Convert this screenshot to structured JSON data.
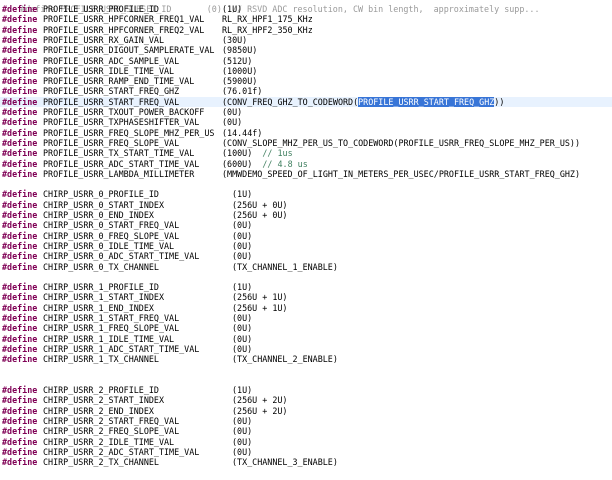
{
  "editor": {
    "top_partial": "#define PROFILE_USRR_SUBSET_ID       (0)  // RSVD ADC resolution, CW bin length,  approximately supp...",
    "lines": [
      {
        "kw": "#define",
        "name": "PROFILE_USRR_PROFILE_ID",
        "value": "(1U)",
        "col": "a"
      },
      {
        "kw": "#define",
        "name": "PROFILE_USRR_HPFCORNER_FREQ1_VAL",
        "value": "RL_RX_HPF1_175_KHz",
        "col": "a"
      },
      {
        "kw": "#define",
        "name": "PROFILE_USRR_HPFCORNER_FREQ2_VAL",
        "value": "RL_RX_HPF2_350_KHz",
        "col": "a"
      },
      {
        "kw": "#define",
        "name": "PROFILE_USRR_RX_GAIN_VAL",
        "value": "(30U)",
        "col": "a"
      },
      {
        "kw": "#define",
        "name": "PROFILE_USRR_DIGOUT_SAMPLERATE_VAL",
        "value": "(9850U)",
        "col": "a"
      },
      {
        "kw": "#define",
        "name": "PROFILE_USRR_ADC_SAMPLE_VAL",
        "value": "(512U)",
        "col": "a"
      },
      {
        "kw": "#define",
        "name": "PROFILE_USRR_IDLE_TIME_VAL",
        "value": "(1000U)",
        "col": "a"
      },
      {
        "kw": "#define",
        "name": "PROFILE_USRR_RAMP_END_TIME_VAL",
        "value": "(5900U)",
        "col": "a"
      },
      {
        "kw": "#define",
        "name": "PROFILE_USRR_START_FREQ_GHZ",
        "value": "(76.01f)",
        "col": "a"
      },
      {
        "kw": "#define",
        "name": "PROFILE_USRR_START_FREQ_VAL",
        "value": "(CONV_FREQ_GHZ_TO_CODEWORD(",
        "selected": "PROFILE_USRR_START_FREQ_GHZ",
        "value_after": "))",
        "col": "a",
        "highlight": true
      },
      {
        "kw": "#define",
        "name": "PROFILE_USRR_TXOUT_POWER_BACKOFF",
        "value": "(0U)",
        "col": "a"
      },
      {
        "kw": "#define",
        "name": "PROFILE_USRR_TXPHASESHIFTER_VAL",
        "value": "(0U)",
        "col": "a"
      },
      {
        "kw": "#define",
        "name": "PROFILE_USRR_FREQ_SLOPE_MHZ_PER_US",
        "value": "(14.44f)",
        "col": "a"
      },
      {
        "kw": "#define",
        "name": "PROFILE_USRR_FREQ_SLOPE_VAL",
        "value": "(CONV_SLOPE_MHZ_PER_US_TO_CODEWORD(PROFILE_USRR_FREQ_SLOPE_MHZ_PER_US))",
        "col": "a"
      },
      {
        "kw": "#define",
        "name": "PROFILE_USRR_TX_START_TIME_VAL",
        "value": "(100U)",
        "comment": "// 1us",
        "col": "a"
      },
      {
        "kw": "#define",
        "name": "PROFILE_USRR_ADC_START_TIME_VAL",
        "value": "(600U)",
        "comment": "// 4.8 us",
        "col": "a"
      },
      {
        "kw": "#define",
        "name": "PROFILE_USRR_LAMBDA_MILLIMETER",
        "value": "(MMWDEMO_SPEED_OF_LIGHT_IN_METERS_PER_USEC/PROFILE_USRR_START_FREQ_GHZ)",
        "col": "a"
      },
      {
        "blank": true
      },
      {
        "kw": "#define",
        "name": "CHIRP_USRR_0_PROFILE_ID",
        "value": "(1U)",
        "col": "b"
      },
      {
        "kw": "#define",
        "name": "CHIRP_USRR_0_START_INDEX",
        "value": "(256U + 0U)",
        "col": "b"
      },
      {
        "kw": "#define",
        "name": "CHIRP_USRR_0_END_INDEX",
        "value": "(256U + 0U)",
        "col": "b"
      },
      {
        "kw": "#define",
        "name": "CHIRP_USRR_0_START_FREQ_VAL",
        "value": "(0U)",
        "col": "b"
      },
      {
        "kw": "#define",
        "name": "CHIRP_USRR_0_FREQ_SLOPE_VAL",
        "value": "(0U)",
        "col": "b"
      },
      {
        "kw": "#define",
        "name": "CHIRP_USRR_0_IDLE_TIME_VAL",
        "value": "(0U)",
        "col": "b"
      },
      {
        "kw": "#define",
        "name": "CHIRP_USRR_0_ADC_START_TIME_VAL",
        "value": "(0U)",
        "col": "b"
      },
      {
        "kw": "#define",
        "name": "CHIRP_USRR_0_TX_CHANNEL",
        "value": "(TX_CHANNEL_1_ENABLE)",
        "col": "b"
      },
      {
        "blank": true
      },
      {
        "kw": "#define",
        "name": "CHIRP_USRR_1_PROFILE_ID",
        "value": "(1U)",
        "col": "b"
      },
      {
        "kw": "#define",
        "name": "CHIRP_USRR_1_START_INDEX",
        "value": "(256U + 1U)",
        "col": "b"
      },
      {
        "kw": "#define",
        "name": "CHIRP_USRR_1_END_INDEX",
        "value": "(256U + 1U)",
        "col": "b"
      },
      {
        "kw": "#define",
        "name": "CHIRP_USRR_1_START_FREQ_VAL",
        "value": "(0U)",
        "col": "b"
      },
      {
        "kw": "#define",
        "name": "CHIRP_USRR_1_FREQ_SLOPE_VAL",
        "value": "(0U)",
        "col": "b"
      },
      {
        "kw": "#define",
        "name": "CHIRP_USRR_1_IDLE_TIME_VAL",
        "value": "(0U)",
        "col": "b"
      },
      {
        "kw": "#define",
        "name": "CHIRP_USRR_1_ADC_START_TIME_VAL",
        "value": "(0U)",
        "col": "b"
      },
      {
        "kw": "#define",
        "name": "CHIRP_USRR_1_TX_CHANNEL",
        "value": "(TX_CHANNEL_2_ENABLE)",
        "col": "b"
      },
      {
        "blank": true
      },
      {
        "blank": true
      },
      {
        "kw": "#define",
        "name": "CHIRP_USRR_2_PROFILE_ID",
        "value": "(1U)",
        "col": "b"
      },
      {
        "kw": "#define",
        "name": "CHIRP_USRR_2_START_INDEX",
        "value": "(256U + 2U)",
        "col": "b"
      },
      {
        "kw": "#define",
        "name": "CHIRP_USRR_2_END_INDEX",
        "value": "(256U + 2U)",
        "col": "b"
      },
      {
        "kw": "#define",
        "name": "CHIRP_USRR_2_START_FREQ_VAL",
        "value": "(0U)",
        "col": "b"
      },
      {
        "kw": "#define",
        "name": "CHIRP_USRR_2_FREQ_SLOPE_VAL",
        "value": "(0U)",
        "col": "b"
      },
      {
        "kw": "#define",
        "name": "CHIRP_USRR_2_IDLE_TIME_VAL",
        "value": "(0U)",
        "col": "b"
      },
      {
        "kw": "#define",
        "name": "CHIRP_USRR_2_ADC_START_TIME_VAL",
        "value": "(0U)",
        "col": "b"
      },
      {
        "kw": "#define",
        "name": "CHIRP_USRR_2_TX_CHANNEL",
        "value": "(TX_CHANNEL_3_ENABLE)",
        "col": "b"
      }
    ]
  },
  "colors": {
    "keyword": "#7f0055",
    "comment": "#3f7f5f",
    "selection": "#3875d7",
    "current_line": "#e8f2fe"
  }
}
